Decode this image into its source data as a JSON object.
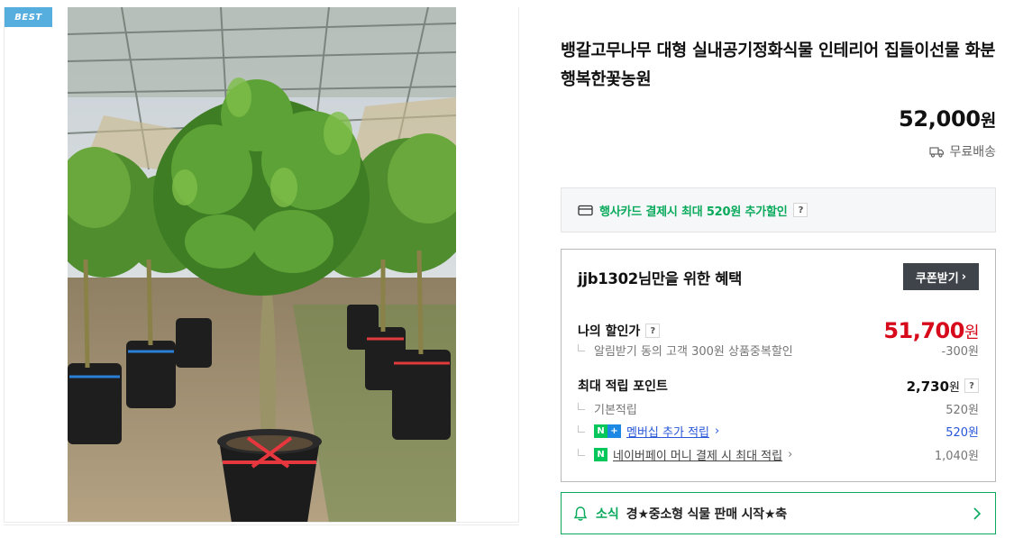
{
  "badge": "BEST",
  "product": {
    "title": "뱅갈고무나무 대형 실내공기정화식물 인테리어 집들이선물 화분 행복한꽃농원",
    "price": "52,000",
    "price_unit": "원",
    "shipping": "무료배송"
  },
  "card_benefit": {
    "text": "행사카드 결제시 최대 520원 추가할인",
    "help": "?"
  },
  "member_benefit": {
    "title": "jjb1302님만을 위한 혜택",
    "coupon_button": "쿠폰받기",
    "my_price_label": "나의 할인가",
    "my_price": "51,700",
    "my_price_unit": "원",
    "discount_desc": "알림받기 동의 고객 300원 상품중복할인",
    "discount_amount": "-300원",
    "points_label": "최대 적립 포인트",
    "points_value": "2,730",
    "points_unit": "원",
    "items": [
      {
        "label": "기본적립",
        "value": "520원"
      },
      {
        "label": "멤버십 추가 적립",
        "value": "520원"
      },
      {
        "label": "네이버페이 머니 결제 시 최대 적립",
        "value": "1,040원"
      }
    ]
  },
  "news": {
    "tag": "소식",
    "text": "경★중소형 식물 판매 시작★축"
  },
  "colors": {
    "green": "#09aa5c",
    "red": "#d60a1a",
    "blue": "#2756d8",
    "badge_blue": "#55aede",
    "dark_button": "#3f434a"
  }
}
